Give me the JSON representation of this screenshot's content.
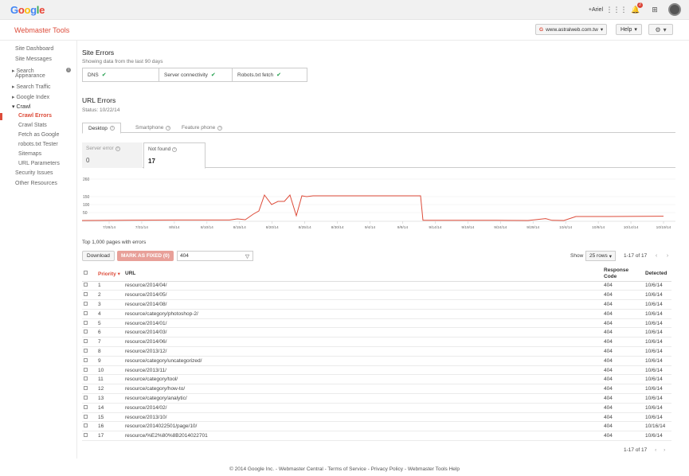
{
  "topbar": {
    "logo_letters": [
      {
        "ch": "G",
        "color": "#4285f4"
      },
      {
        "ch": "o",
        "color": "#ea4335"
      },
      {
        "ch": "o",
        "color": "#fbbc05"
      },
      {
        "ch": "g",
        "color": "#4285f4"
      },
      {
        "ch": "l",
        "color": "#34a853"
      },
      {
        "ch": "e",
        "color": "#ea4335"
      }
    ],
    "user": "+Ariel",
    "notification_count": "2"
  },
  "header": {
    "app_title": "Webmaster Tools",
    "site": "www.astralweb.com.tw",
    "help": "Help"
  },
  "sidebar": {
    "items": [
      {
        "label": "Site Dashboard"
      },
      {
        "label": "Site Messages"
      },
      {
        "label": "▸ Search"
      },
      {
        "label": "Appearance"
      },
      {
        "label": "▸ Search Traffic"
      },
      {
        "label": "▸ Google Index"
      },
      {
        "label": "▾ Crawl"
      },
      {
        "label": "Crawl Errors"
      },
      {
        "label": "Crawl Stats"
      },
      {
        "label": "Fetch as Google"
      },
      {
        "label": "robots.txt Tester"
      },
      {
        "label": "Sitemaps"
      },
      {
        "label": "URL Parameters"
      },
      {
        "label": "Security Issues"
      },
      {
        "label": "Other Resources"
      }
    ]
  },
  "site_errors": {
    "title": "Site Errors",
    "subtitle": "Showing data from the last 90 days",
    "cells": [
      {
        "label": "DNS"
      },
      {
        "label": "Server connectivity"
      },
      {
        "label": "Robots.txt fetch"
      }
    ]
  },
  "url_errors": {
    "title": "URL Errors",
    "status": "Status: 10/22/14",
    "tabs": [
      {
        "label": "Desktop"
      },
      {
        "label": "Smartphone"
      },
      {
        "label": "Feature phone"
      }
    ],
    "cards": [
      {
        "label": "Server error",
        "value": "0"
      },
      {
        "label": "Not found",
        "value": "17"
      }
    ]
  },
  "chart_data": {
    "type": "line",
    "yticks": [
      260,
      150,
      100,
      50
    ],
    "ylim": [
      0,
      260
    ],
    "x_labels": [
      "7/28/14",
      "7/31/14",
      "8/5/14",
      "8/10/14",
      "8/15/14",
      "8/20/14",
      "8/25/14",
      "8/30/14",
      "9/4/14",
      "9/9/14",
      "9/14/14",
      "9/19/14",
      "9/24/14",
      "9/29/14",
      "10/4/14",
      "10/9/14",
      "10/14/14",
      "10/19/14"
    ],
    "series": [
      {
        "color": "#dd4b39",
        "points": [
          [
            0,
            0
          ],
          [
            60,
            2
          ],
          [
            120,
            3
          ],
          [
            185,
            3
          ],
          [
            195,
            10
          ],
          [
            205,
            5
          ],
          [
            215,
            40
          ],
          [
            222,
            60
          ],
          [
            229,
            160
          ],
          [
            238,
            100
          ],
          [
            246,
            120
          ],
          [
            254,
            120
          ],
          [
            261,
            160
          ],
          [
            269,
            30
          ],
          [
            276,
            155
          ],
          [
            282,
            150
          ],
          [
            290,
            155
          ],
          [
            325,
            155
          ],
          [
            380,
            155
          ],
          [
            425,
            155
          ],
          [
            428,
            1
          ],
          [
            520,
            1
          ],
          [
            560,
            0
          ],
          [
            582,
            12
          ],
          [
            590,
            1
          ],
          [
            605,
            0
          ],
          [
            620,
            25
          ],
          [
            660,
            25
          ],
          [
            730,
            27
          ]
        ]
      }
    ]
  },
  "table": {
    "heading": "Top 1,000 pages with errors",
    "download": "Download",
    "mark_fixed": "MARK AS FIXED (0)",
    "filter_value": "404",
    "show_label": "Show",
    "rows_option": "25 rows",
    "pager": "1-17 of 17",
    "columns": {
      "priority": "Priority",
      "url": "URL",
      "response_code_1": "Response",
      "response_code_2": "Code",
      "detected": "Detected"
    },
    "rows": [
      {
        "p": "1",
        "url": "resource/2014/04/",
        "code": "404",
        "date": "10/6/14"
      },
      {
        "p": "2",
        "url": "resource/2014/05/",
        "code": "404",
        "date": "10/6/14"
      },
      {
        "p": "3",
        "url": "resource/2014/08/",
        "code": "404",
        "date": "10/6/14"
      },
      {
        "p": "4",
        "url": "resource/category/photoshop-2/",
        "code": "404",
        "date": "10/6/14"
      },
      {
        "p": "5",
        "url": "resource/2014/01/",
        "code": "404",
        "date": "10/6/14"
      },
      {
        "p": "6",
        "url": "resource/2014/03/",
        "code": "404",
        "date": "10/6/14"
      },
      {
        "p": "7",
        "url": "resource/2014/06/",
        "code": "404",
        "date": "10/6/14"
      },
      {
        "p": "8",
        "url": "resource/2013/12/",
        "code": "404",
        "date": "10/6/14"
      },
      {
        "p": "9",
        "url": "resource/category/uncategorized/",
        "code": "404",
        "date": "10/6/14"
      },
      {
        "p": "10",
        "url": "resource/2013/11/",
        "code": "404",
        "date": "10/6/14"
      },
      {
        "p": "11",
        "url": "resource/category/tool/",
        "code": "404",
        "date": "10/6/14"
      },
      {
        "p": "12",
        "url": "resource/category/how-to/",
        "code": "404",
        "date": "10/6/14"
      },
      {
        "p": "13",
        "url": "resource/category/analytic/",
        "code": "404",
        "date": "10/6/14"
      },
      {
        "p": "14",
        "url": "resource/2014/02/",
        "code": "404",
        "date": "10/6/14"
      },
      {
        "p": "15",
        "url": "resource/2013/10/",
        "code": "404",
        "date": "10/6/14"
      },
      {
        "p": "16",
        "url": "resource/2014022501/page/10/",
        "code": "404",
        "date": "10/16/14"
      },
      {
        "p": "17",
        "url": "resource/%E2%80%8B2014022701",
        "code": "404",
        "date": "10/6/14"
      }
    ]
  },
  "footer": {
    "text": "© 2014 Google Inc. - Webmaster Central - Terms of Service - Privacy Policy - Webmaster Tools Help"
  }
}
